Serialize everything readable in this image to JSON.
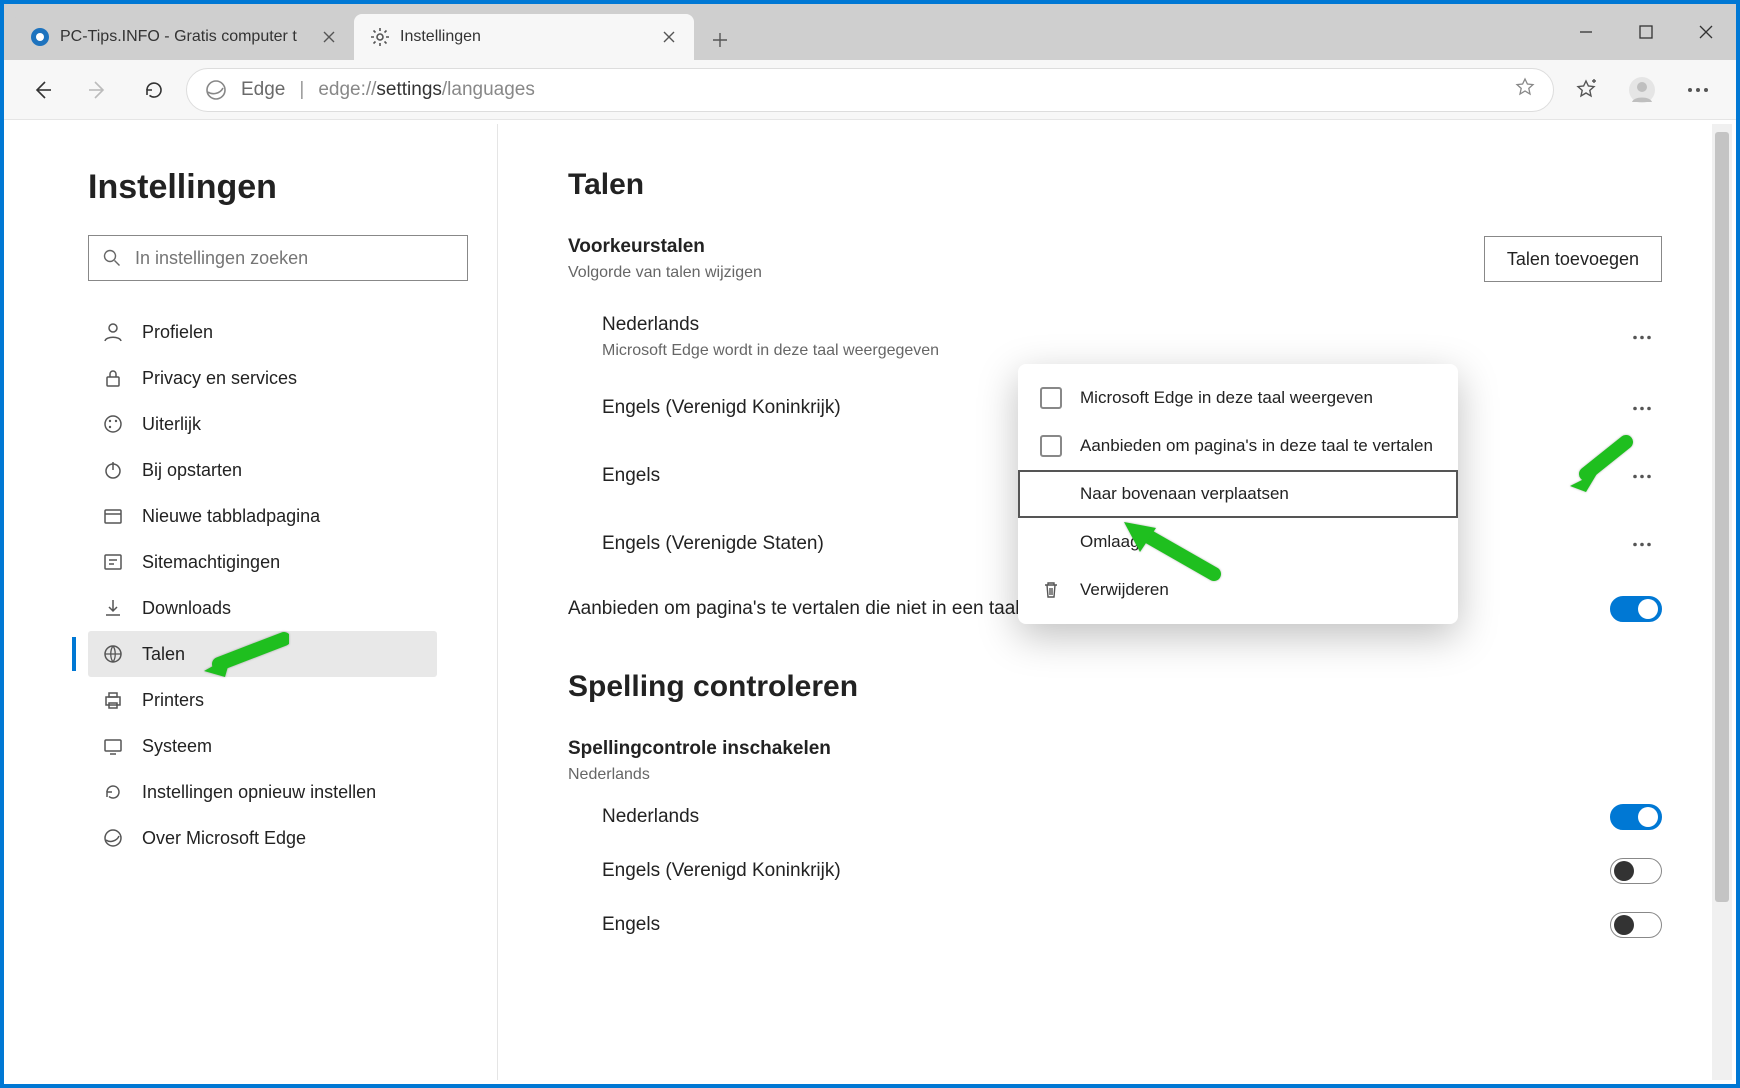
{
  "tabs": {
    "t0": {
      "title": "PC-Tips.INFO - Gratis computer t"
    },
    "t1": {
      "title": "Instellingen"
    }
  },
  "toolbar": {
    "proto_label": "Edge",
    "url_host": "edge://",
    "url_bold": "settings",
    "url_tail": "/languages"
  },
  "sidebar": {
    "title": "Instellingen",
    "search_placeholder": "In instellingen zoeken",
    "items": {
      "profiles": "Profielen",
      "privacy": "Privacy en services",
      "appearance": "Uiterlijk",
      "startup": "Bij opstarten",
      "newtab": "Nieuwe tabbladpagina",
      "siteperm": "Sitemachtigingen",
      "downloads": "Downloads",
      "languages": "Talen",
      "printers": "Printers",
      "system": "Systeem",
      "reset": "Instellingen opnieuw instellen",
      "about": "Over Microsoft Edge"
    }
  },
  "main": {
    "heading": "Talen",
    "pref": {
      "title": "Voorkeurstalen",
      "sub": "Volgorde van talen wijzigen",
      "add_btn": "Talen toevoegen"
    },
    "langs": {
      "nl": {
        "title": "Nederlands",
        "sub": "Microsoft Edge wordt in deze taal weergegeven"
      },
      "en_uk": {
        "title": "Engels (Verenigd Koninkrijk)"
      },
      "en": {
        "title": "Engels"
      },
      "en_us": {
        "title": "Engels (Verenigde Staten)"
      }
    },
    "translate_toggle_label": "Aanbieden om pagina's te vertalen die niet in een taal zijn die u kunt lezen",
    "spell_heading": "Spelling controleren",
    "spell_enable": {
      "title": "Spellingcontrole inschakelen",
      "sub": "Nederlands"
    },
    "spell_langs": {
      "nl": "Nederlands",
      "en_uk": "Engels (Verenigd Koninkrijk)",
      "en": "Engels"
    }
  },
  "popup": {
    "display_lang": "Microsoft Edge in deze taal weergeven",
    "offer_translate": "Aanbieden om pagina's in deze taal te vertalen",
    "move_top": "Naar bovenaan verplaatsen",
    "move_down": "Omlaag",
    "remove": "Verwijderen"
  }
}
